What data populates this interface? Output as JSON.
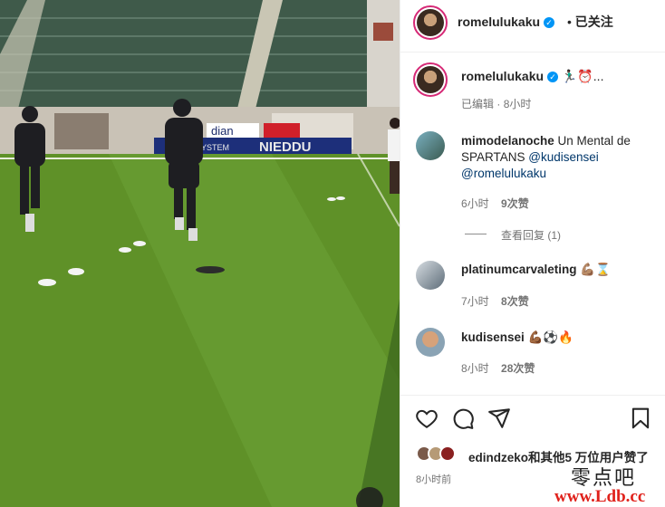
{
  "post": {
    "author": "romelulukaku",
    "follow_state": "已关注",
    "caption_suffix": "🏃🏿‍♂️⏰...",
    "edited_label": "已编辑",
    "edited_time": "8小时"
  },
  "banner": {
    "text": "NIEDDU"
  },
  "comments": [
    {
      "user": "mimodelanoche",
      "text_line1": "Un Mental de",
      "text_line2": "SPARTANS",
      "mention1": "@kudisensei",
      "mention2": "@romelulukaku",
      "time": "6小时",
      "likes": "9次赞",
      "replies": "查看回复 (1)"
    },
    {
      "user": "platinumcarvaleting",
      "text": "💪🏽⌛",
      "time": "7小时",
      "likes": "8次赞"
    },
    {
      "user": "kudisensei",
      "text": "💪🏾⚽🔥",
      "time": "8小时",
      "likes": "28次赞"
    }
  ],
  "likes_line": {
    "user": "edindzeko",
    "rest": "和其他5 万位用户赞了"
  },
  "timestamp": "8小时前",
  "watermark": {
    "logo": "零点吧",
    "url": "www.Ldb.cc"
  },
  "colors": {
    "verified": "#0095f6",
    "mention": "#00376b",
    "ring": "#d62976"
  },
  "icons": [
    "heart-icon",
    "comment-icon",
    "share-icon",
    "bookmark-icon",
    "verified-badge-icon"
  ]
}
